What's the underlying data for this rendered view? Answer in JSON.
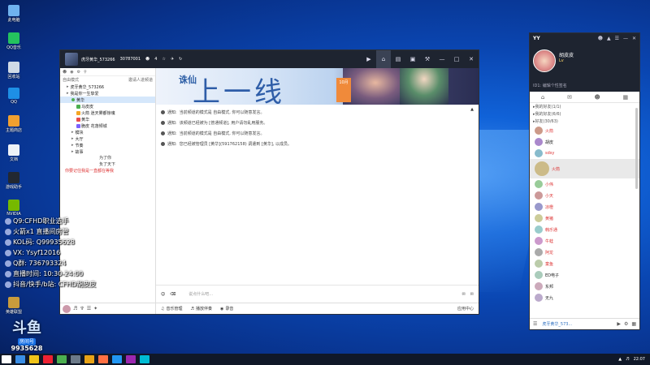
{
  "desktop": {
    "icons": [
      {
        "label": "此电脑",
        "color": "#6fb3ef"
      },
      {
        "label": "QQ音乐",
        "color": "#24c35e"
      },
      {
        "label": "回收站",
        "color": "#d0dae6"
      },
      {
        "label": "QQ",
        "color": "#1e8fe6"
      },
      {
        "label": "主题商店",
        "color": "#f0a030"
      },
      {
        "label": "文档",
        "color": "#eef2f7"
      },
      {
        "label": "游戏助手",
        "color": "#222831"
      },
      {
        "label": "NVIDIA",
        "color": "#76b900"
      },
      {
        "label": "英雄联盟",
        "color": "#c89b3c"
      }
    ]
  },
  "overlay": {
    "lines": [
      "Q9:CFHD职业选手",
      "火箭x1 直播间房管",
      "KOL码: Q99935628",
      "VX: Ysyf12016",
      "Q群: 736793324",
      "直播时间: 10:30-24:00",
      "抖音/快手/b站: CFHD胡皮皮"
    ],
    "logo_text": "斗鱼",
    "logo_sub": "房间号",
    "logo_number": "9935628"
  },
  "yy_window": {
    "room_title": "虎牙黄华_573266",
    "room_id": "30787001",
    "online_count": "4",
    "left": {
      "mode_label": "自由模式",
      "invite_label": "邀请人进频道",
      "tree": [
        {
          "text": "虎牙黄华_573266",
          "type": "root"
        },
        {
          "text": "我是你一生挚爱",
          "type": "sub"
        },
        {
          "text": "黄华",
          "type": "selected"
        },
        {
          "text": "马皮皮",
          "type": "user"
        },
        {
          "text": "火箭  迷天雾都惊魂",
          "type": "user"
        },
        {
          "text": "黄华",
          "type": "user"
        },
        {
          "text": "脆皮  花落倾城",
          "type": "user"
        },
        {
          "text": "模块",
          "type": "group"
        },
        {
          "text": "大厅",
          "type": "group"
        },
        {
          "text": "节奏",
          "type": "group"
        },
        {
          "text": "故事",
          "type": "group"
        }
      ],
      "note1": "为了你",
      "note2": "负了天下",
      "red_note": "你要记住我是一直都在等我"
    },
    "banner": {
      "logo": "诛仙",
      "big_text": "上一线",
      "tag": "10月"
    },
    "notices": [
      {
        "prefix": "通知:",
        "text": "当前频道的模式是 自由模式, 你可以随意发言。"
      },
      {
        "prefix": "通知:",
        "text": "该频道已经被为 [普通频道], 用户请勿乱用服务。"
      },
      {
        "prefix": "通知:",
        "text": "当前频道的模式是 自由模式, 你可以随意发言。"
      },
      {
        "prefix": "通知:",
        "text": "您已经被管理员 [黄华](591762158) 调遣到 [黄华], 以成员。"
      }
    ],
    "input_placeholder": "说点什么吧...",
    "bottom": {
      "sound_label": "音乐管理",
      "music_label": "播放伴奏",
      "record_label": "录音",
      "app_center": "应用中心"
    }
  },
  "side_panel": {
    "app_name": "YY",
    "nickname": "胡皮皮",
    "level": "Lv",
    "signature": "ID1: 编辑个性签名",
    "groups": [
      "我的好友(1/1)",
      "我的好友(6/6)",
      "好友(30/63)"
    ],
    "friends": [
      {
        "name": "火箭",
        "color": "#d33"
      },
      {
        "name": "胡皮",
        "color": "#222"
      },
      {
        "name": "sdsy",
        "color": "#d33"
      },
      {
        "name": "火箭",
        "color": "#d33"
      },
      {
        "name": "小伟",
        "color": "#d33"
      },
      {
        "name": "小天",
        "color": "#d33"
      },
      {
        "name": "凉橙",
        "color": "#d33"
      },
      {
        "name": "黄猪",
        "color": "#d33"
      },
      {
        "name": "韩乐通",
        "color": "#d33"
      },
      {
        "name": "牛蛙",
        "color": "#d33"
      },
      {
        "name": "阿龙",
        "color": "#d33"
      },
      {
        "name": "童鱼",
        "color": "#d33"
      },
      {
        "name": "ED电子",
        "color": "#222"
      },
      {
        "name": "东邦",
        "color": "#222"
      },
      {
        "name": "无九",
        "color": "#222"
      }
    ],
    "footer_name": "虎牙黄华_573..."
  },
  "taskbar": {
    "time": "22:07",
    "items": [
      "#ffffff",
      "#3a8ee6",
      "#f0c419",
      "#e23",
      "#4caf50",
      "#6c7a89",
      "#e8a317",
      "#ff7043",
      "#2196f3",
      "#9c27b0",
      "#00bcd4"
    ]
  }
}
